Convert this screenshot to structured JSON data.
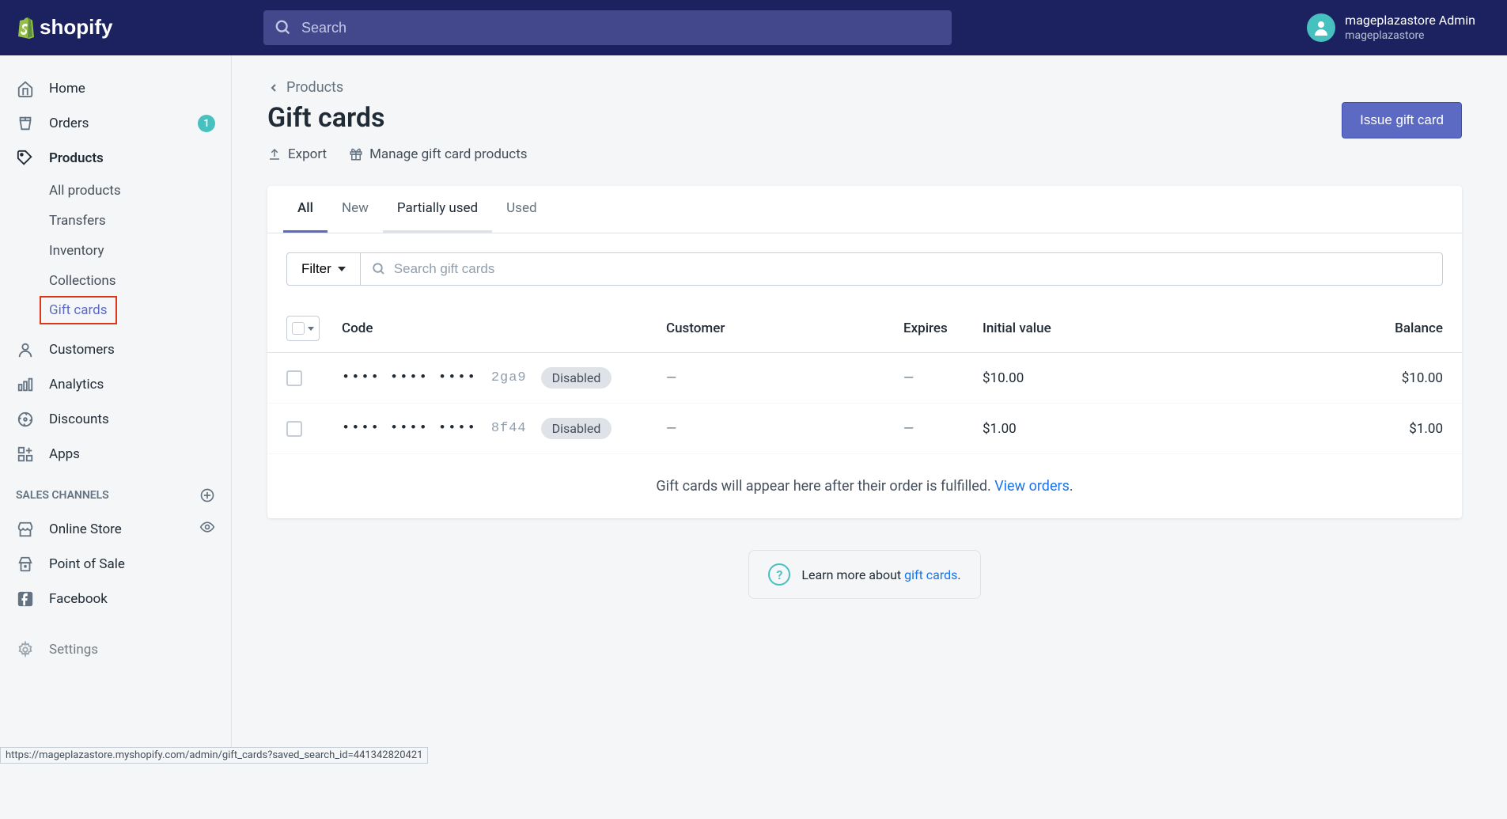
{
  "topbar": {
    "search_placeholder": "Search",
    "user_name": "mageplazastore Admin",
    "store_name": "mageplazastore"
  },
  "sidebar": {
    "home": "Home",
    "orders": "Orders",
    "orders_badge": "1",
    "products": "Products",
    "all_products": "All products",
    "transfers": "Transfers",
    "inventory": "Inventory",
    "collections": "Collections",
    "gift_cards": "Gift cards",
    "customers": "Customers",
    "analytics": "Analytics",
    "discounts": "Discounts",
    "apps": "Apps",
    "sales_channels": "SALES CHANNELS",
    "online_store": "Online Store",
    "point_of_sale": "Point of Sale",
    "facebook": "Facebook",
    "settings": "Settings"
  },
  "page": {
    "breadcrumb": "Products",
    "title": "Gift cards",
    "export": "Export",
    "manage": "Manage gift card products",
    "issue_btn": "Issue gift card"
  },
  "tabs": {
    "all": "All",
    "new": "New",
    "partially": "Partially used",
    "used": "Used"
  },
  "filter": {
    "label": "Filter",
    "search_placeholder": "Search gift cards"
  },
  "columns": {
    "code": "Code",
    "customer": "Customer",
    "expires": "Expires",
    "initial": "Initial value",
    "balance": "Balance"
  },
  "rows": [
    {
      "dots": "•••• •••• ••••",
      "suffix": "2ga9",
      "status": "Disabled",
      "customer": "—",
      "expires": "—",
      "initial": "$10.00",
      "balance": "$10.00"
    },
    {
      "dots": "•••• •••• ••••",
      "suffix": "8f44",
      "status": "Disabled",
      "customer": "—",
      "expires": "—",
      "initial": "$1.00",
      "balance": "$1.00"
    }
  ],
  "empty": {
    "msg": "Gift cards will appear here after their order is fulfilled. ",
    "link": "View orders",
    "dot": "."
  },
  "learn": {
    "prefix": "Learn more about ",
    "link": "gift cards",
    "dot": "."
  },
  "status_url": "https://mageplazastore.myshopify.com/admin/gift_cards?saved_search_id=441342820421"
}
